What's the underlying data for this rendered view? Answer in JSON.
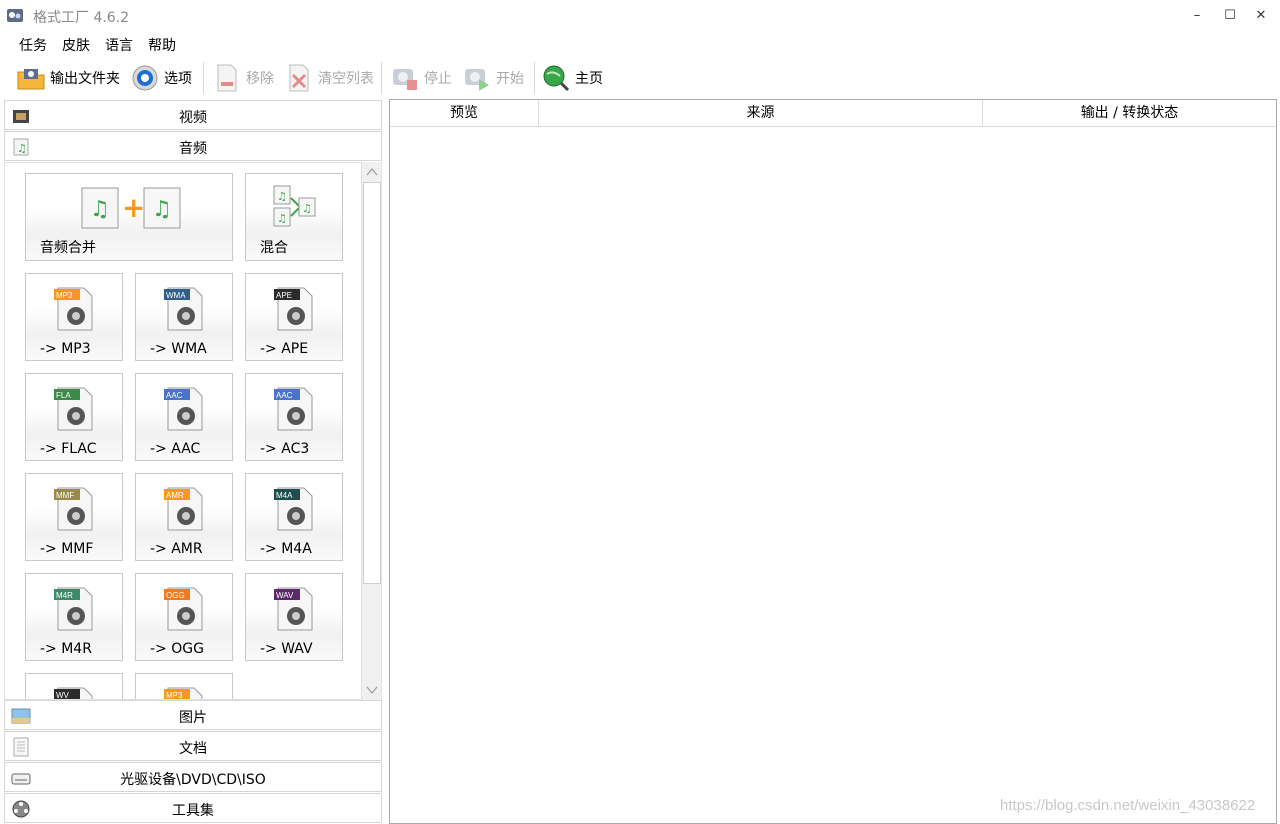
{
  "window": {
    "title": "格式工厂 4.6.2"
  },
  "menu": [
    "任务",
    "皮肤",
    "语言",
    "帮助"
  ],
  "toolbar": {
    "output_folder": "输出文件夹",
    "options": "选项",
    "remove": "移除",
    "clear_list": "清空列表",
    "stop": "停止",
    "start": "开始",
    "home": "主页"
  },
  "categories": {
    "video": "视频",
    "audio": "音频",
    "image": "图片",
    "document": "文档",
    "disc": "光驱设备\\DVD\\CD\\ISO",
    "tools": "工具集"
  },
  "audio_tiles": [
    {
      "label": "音频合并",
      "badge": ""
    },
    {
      "label": "混合",
      "badge": ""
    },
    {
      "label": "-> MP3",
      "badge": "MP3",
      "color": "#f39a1e"
    },
    {
      "label": "-> WMA",
      "badge": "WMA",
      "color": "#2e5f8a"
    },
    {
      "label": "-> APE",
      "badge": "APE",
      "color": "#2b2b2b"
    },
    {
      "label": "-> FLAC",
      "badge": "FLA",
      "color": "#3c8a4a"
    },
    {
      "label": "-> AAC",
      "badge": "AAC",
      "color": "#4a73c9"
    },
    {
      "label": "-> AC3",
      "badge": "AAC",
      "color": "#4a73c9"
    },
    {
      "label": "-> MMF",
      "badge": "MMF",
      "color": "#9a8a4a"
    },
    {
      "label": "-> AMR",
      "badge": "AMR",
      "color": "#f39a1e"
    },
    {
      "label": "-> M4A",
      "badge": "M4A",
      "color": "#1f4e4e"
    },
    {
      "label": "-> M4R",
      "badge": "M4R",
      "color": "#3c8a6a"
    },
    {
      "label": "-> OGG",
      "badge": "OGG",
      "color": "#f07a1e"
    },
    {
      "label": "-> WAV",
      "badge": "WAV",
      "color": "#5a2a6a"
    },
    {
      "label": "",
      "badge": "WV",
      "color": "#2b2b2b"
    },
    {
      "label": "",
      "badge": "MP3",
      "color": "#f39a1e"
    }
  ],
  "table": {
    "columns": [
      "预览",
      "来源",
      "输出 / 转换状态"
    ]
  },
  "watermark": "https://blog.csdn.net/weixin_43038622"
}
